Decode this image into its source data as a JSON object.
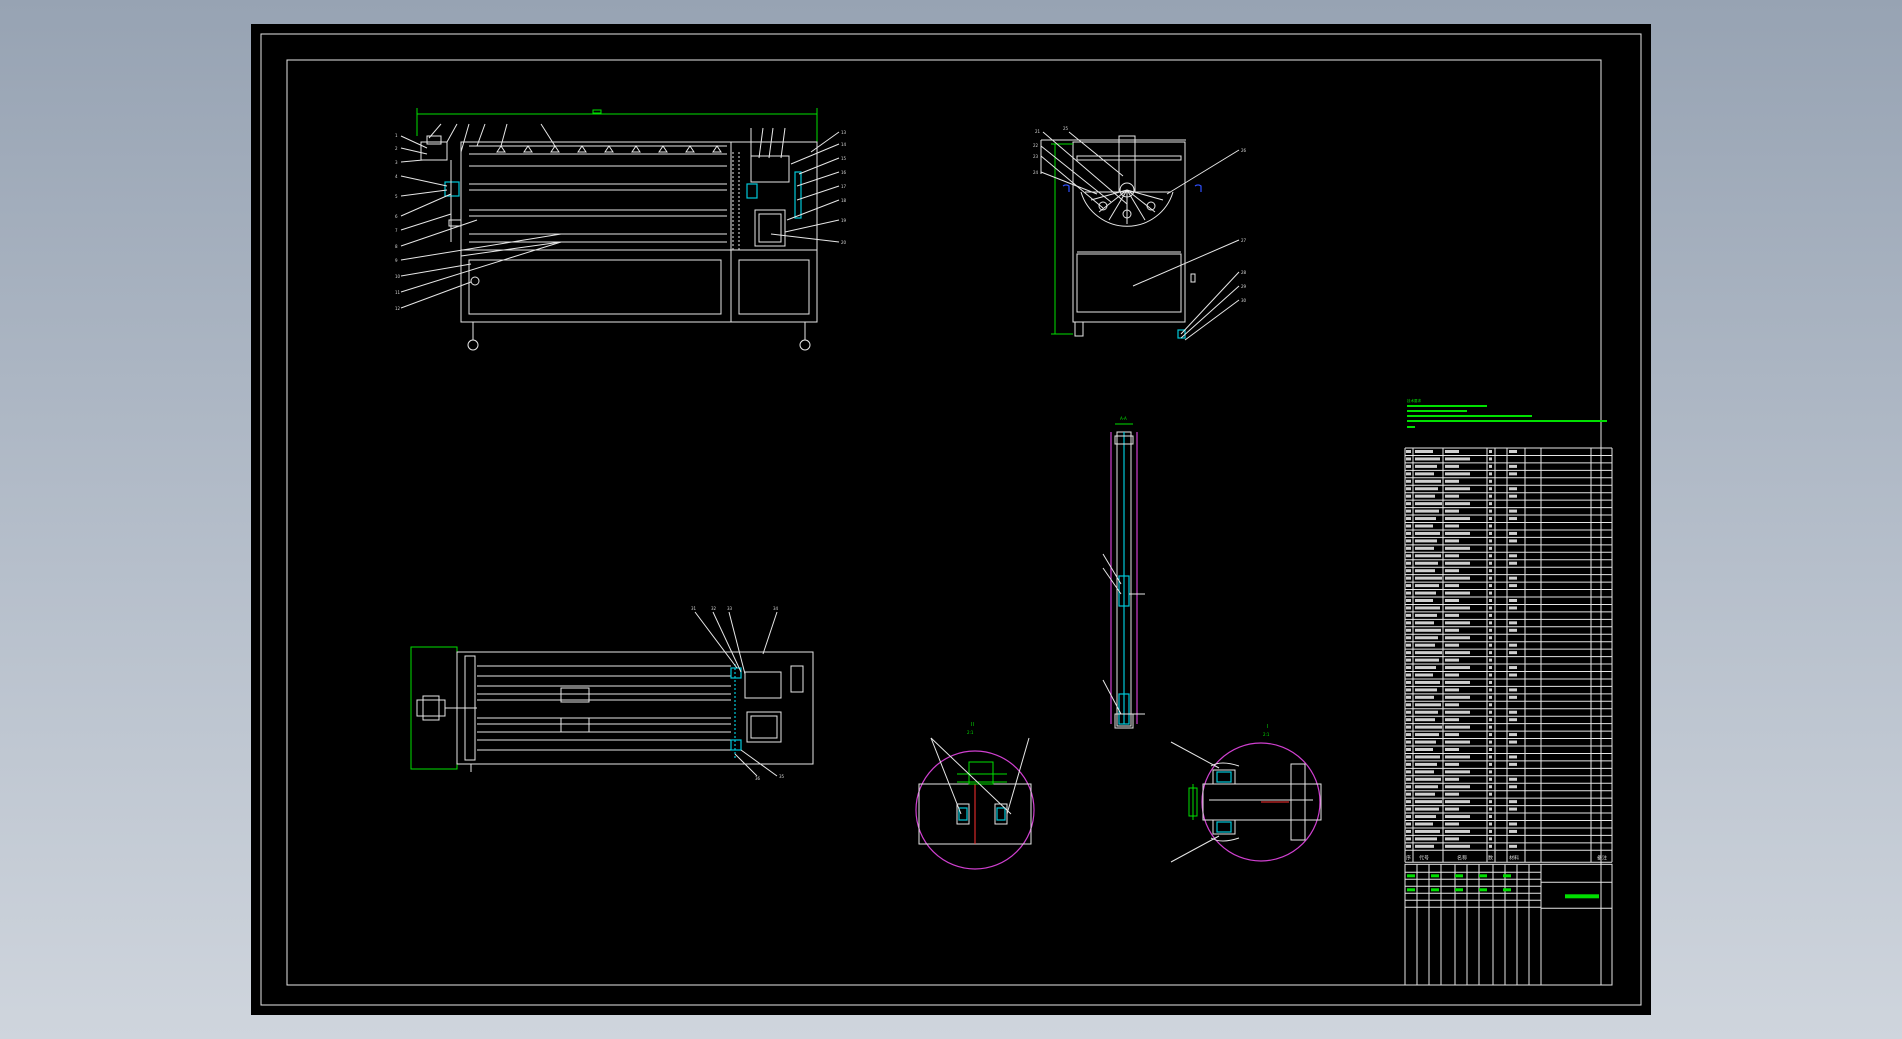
{
  "drawing": {
    "title_block_name": "",
    "table_header": [
      "序",
      "代号",
      "名称",
      "数",
      "材料",
      "",
      "",
      "备注"
    ],
    "rows": 54
  },
  "colors": {
    "background": "#000000",
    "frame": "#e6e6e6",
    "dimension": "#00e000",
    "cyan": "#00c8d8",
    "magenta": "#d040d0",
    "red": "#ff3030"
  }
}
